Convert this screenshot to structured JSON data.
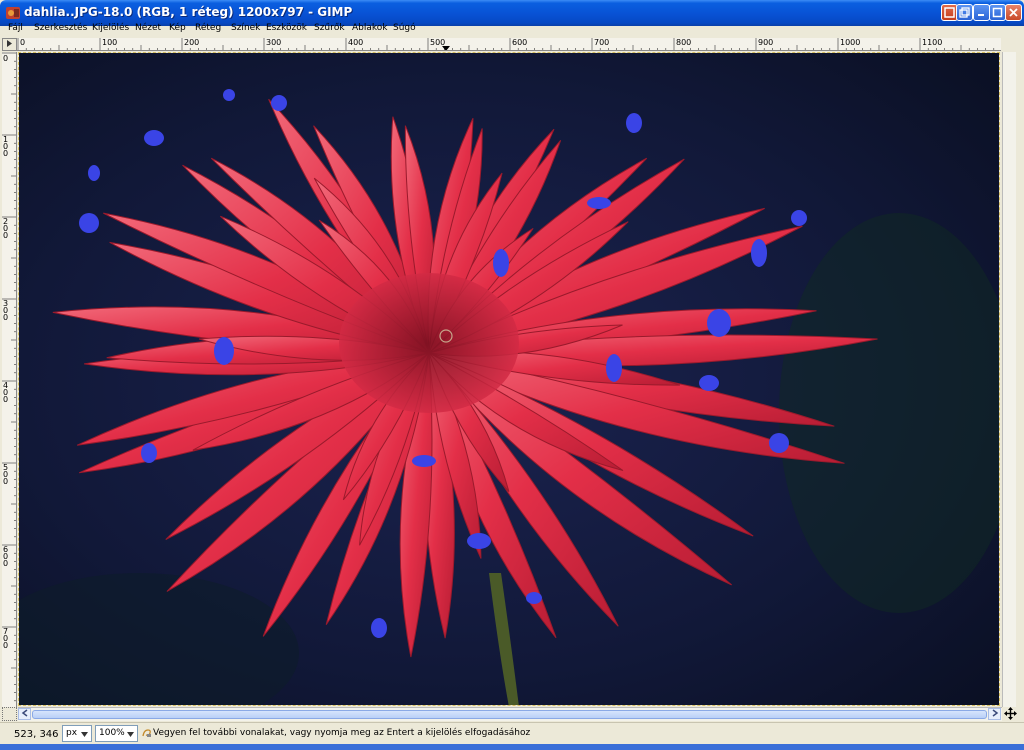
{
  "window": {
    "title": "dahlia..JPG-18.0 (RGB, 1 réteg) 1200x797 - GIMP",
    "colors": {
      "titlebar": "#0853d6",
      "accent": "#3c8cf5"
    }
  },
  "menu": {
    "items": [
      {
        "label": "Fájl"
      },
      {
        "label": "Szerkesztés"
      },
      {
        "label": "Kijelölés"
      },
      {
        "label": "Nézet"
      },
      {
        "label": "Kép"
      },
      {
        "label": "Réteg"
      },
      {
        "label": "Színek"
      },
      {
        "label": "Eszközök"
      },
      {
        "label": "Szűrők"
      },
      {
        "label": "Ablakok"
      },
      {
        "label": "Súgó"
      }
    ]
  },
  "rulers": {
    "horizontal_ticks": [
      "0",
      "100",
      "200",
      "300",
      "400",
      "500",
      "600",
      "700",
      "800",
      "900",
      "1000",
      "1100"
    ],
    "vertical_ticks": [
      "0",
      "100",
      "200",
      "300",
      "400",
      "500",
      "600",
      "700"
    ]
  },
  "image": {
    "subject": "red dahlia flower with blue highlighted selection areas on dark background",
    "colors": {
      "petal": "#e8344e",
      "selection": "#3a4ae8",
      "background": "#0f1430"
    }
  },
  "status": {
    "coordinates": "523, 346",
    "unit": "px",
    "zoom": "100%",
    "message": "Vegyen fel további vonalakat, vagy nyomja meg az Entert a kijelölés elfogadásához"
  }
}
